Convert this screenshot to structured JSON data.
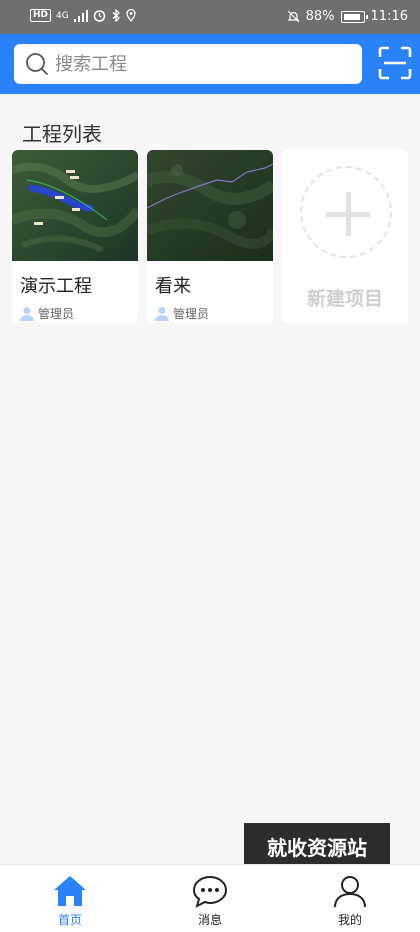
{
  "status_bar": {
    "hd": "HD",
    "network": "4G",
    "battery": "88%",
    "time": "11:16"
  },
  "search": {
    "placeholder": "搜索工程"
  },
  "section": {
    "title": "工程列表"
  },
  "projects": [
    {
      "name": "演示工程",
      "owner": "管理员"
    },
    {
      "name": "看来",
      "owner": "管理员"
    }
  ],
  "new_project": {
    "label": "新建项目"
  },
  "watermark": "就收资源站",
  "tabs": [
    {
      "label": "首页",
      "icon": "home-icon",
      "active": true
    },
    {
      "label": "消息",
      "icon": "chat-icon",
      "active": false
    },
    {
      "label": "我的",
      "icon": "user-icon",
      "active": false
    }
  ],
  "colors": {
    "accent": "#2a82f8",
    "status_bar": "#6f6f6f",
    "background": "#f7f7f7"
  }
}
